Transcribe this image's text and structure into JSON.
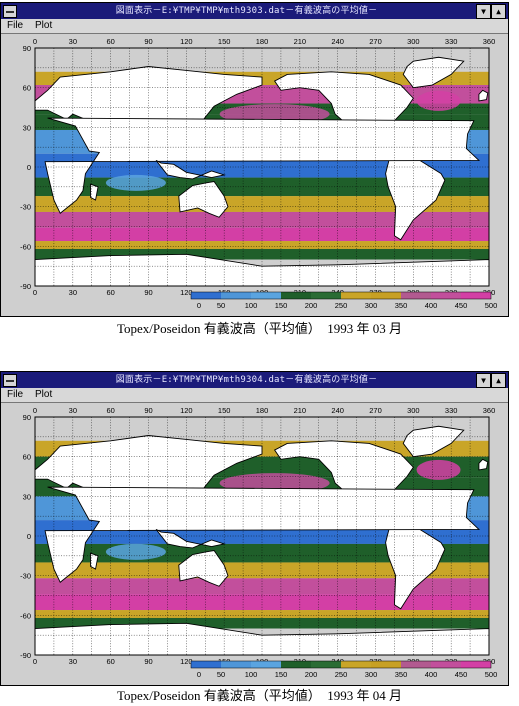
{
  "colors": {
    "band_0_50": "#2f6fd0",
    "band_50_100": "#4f96d8",
    "band_100_150": "#5aa4e0",
    "band_150_200": "#1f5f2a",
    "band_200_250": "#2a6c34",
    "band_250_300": "#c9a528",
    "band_300_350": "#c7a024",
    "band_350_400": "#b25a90",
    "band_400_450": "#c24f9c",
    "band_450_500": "#d33fa5",
    "land": "#ffffff",
    "window_title": "#1b1b7a"
  },
  "panels": [
    {
      "window": {
        "title": "図面表示－E:¥TMP¥TMP¥mth9303.dat－有義波高の平均値－",
        "minimize_label": "▼",
        "maximize_label": "▲",
        "menu": {
          "file": "File",
          "plot": "Plot"
        }
      },
      "top_ticks": [
        "0",
        "30",
        "60",
        "90",
        "120",
        "150",
        "180",
        "210",
        "240",
        "270",
        "300",
        "330",
        "360"
      ],
      "bottom_ticks": [
        "0",
        "30",
        "60",
        "90",
        "120",
        "150",
        "180",
        "210",
        "240",
        "270",
        "300",
        "330",
        "360"
      ],
      "lat_ticks": [
        "90",
        "60",
        "30",
        "0",
        "-30",
        "-60",
        "-90"
      ],
      "colorbar": {
        "labels": [
          "0",
          "50",
          "100",
          "150",
          "200",
          "250",
          "300",
          "350",
          "400",
          "450",
          "500"
        ]
      },
      "caption": "Topex/Poseidon 有義波高（平均値）　1993 年 03 月"
    },
    {
      "window": {
        "title": "図面表示－E:¥TMP¥TMP¥mth9304.dat－有義波高の平均値－",
        "minimize_label": "▼",
        "maximize_label": "▲",
        "menu": {
          "file": "File",
          "plot": "Plot"
        }
      },
      "top_ticks": [
        "0",
        "30",
        "60",
        "90",
        "120",
        "150",
        "180",
        "210",
        "240",
        "270",
        "300",
        "330",
        "360"
      ],
      "bottom_ticks": [
        "0",
        "30",
        "60",
        "90",
        "120",
        "150",
        "180",
        "210",
        "240",
        "270",
        "300",
        "330",
        "360"
      ],
      "lat_ticks": [
        "90",
        "60",
        "30",
        "0",
        "-30",
        "-60",
        "-90"
      ],
      "colorbar": {
        "labels": [
          "0",
          "50",
          "100",
          "150",
          "200",
          "250",
          "300",
          "350",
          "400",
          "450",
          "500"
        ]
      },
      "caption": "Topex/Poseidon 有義波高（平均値）　1993 年 04 月"
    }
  ]
}
